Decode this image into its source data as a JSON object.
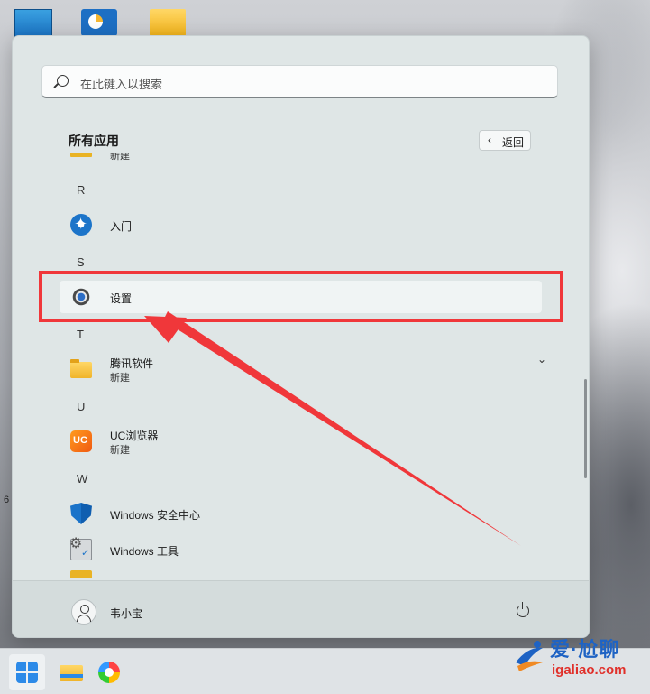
{
  "search": {
    "placeholder": "在此键入以搜索"
  },
  "all_apps": {
    "title": "所有应用",
    "back_label": "返回"
  },
  "partial_item": {
    "subtitle": "新建"
  },
  "sections": [
    {
      "letter": "R"
    },
    {
      "letter": "S"
    },
    {
      "letter": "T"
    },
    {
      "letter": "U"
    },
    {
      "letter": "W"
    }
  ],
  "apps": {
    "intro": {
      "name": "入门",
      "icon": "intro-icon"
    },
    "settings": {
      "name": "设置",
      "icon": "gear-icon"
    },
    "tencent": {
      "name": "腾讯软件",
      "subtitle": "新建",
      "icon": "folder-icon"
    },
    "uc": {
      "name": "UC浏览器",
      "subtitle": "新建",
      "icon": "uc-browser-icon"
    },
    "security": {
      "name": "Windows 安全中心",
      "icon": "shield-icon"
    },
    "tools": {
      "name": "Windows 工具",
      "icon": "tools-icon"
    }
  },
  "footer": {
    "user_name": "韦小宝"
  },
  "annotation": {
    "color": "#f0373a"
  },
  "watermark": {
    "title": "爱·尬聊",
    "url": "igaliao.com"
  },
  "desktop": {
    "edge_text": "6"
  }
}
